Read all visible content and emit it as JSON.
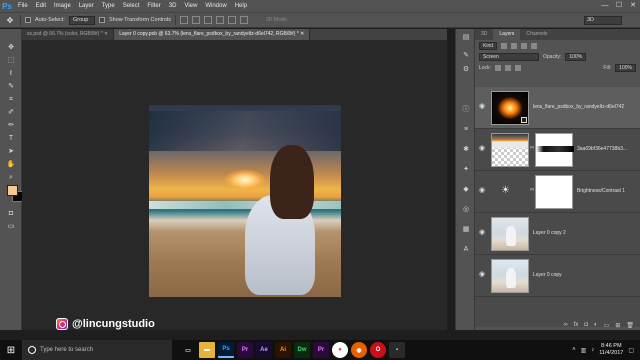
{
  "app": {
    "logo": "Ps"
  },
  "menu": [
    "File",
    "Edit",
    "Image",
    "Layer",
    "Type",
    "Select",
    "Filter",
    "3D",
    "View",
    "Window",
    "Help"
  ],
  "window_controls": {
    "minimize": "—",
    "maximize": "☐",
    "close": "✕"
  },
  "options": {
    "auto_select_label": "Auto-Select:",
    "auto_select_value": "Group",
    "transform_label": "Show Transform Controls",
    "mode_3d": "3D Mode:",
    "search_value": "3D"
  },
  "tabs": [
    {
      "label": "ss.psd @ 66.7% (color, RGB/8#) * ✕",
      "active": false
    },
    {
      "label": "Layer 0 copy.psb @ 63.7% (lens_flare_psdbox_by_randyeltz-d6el742, RGB/8#) * ✕",
      "active": true
    }
  ],
  "watermark": {
    "handle": "@lincungstudio",
    "icon": "instagram-icon"
  },
  "layers_panel": {
    "tabs": [
      "3D",
      "Layers",
      "Channels"
    ],
    "active_tab": "Layers",
    "filter_kind": "Kind",
    "blend_mode": "Screen",
    "opacity_label": "Opacity:",
    "opacity_value": "100%",
    "lock_label": "Lock:",
    "fill_label": "Fill:",
    "fill_value": "100%",
    "layers": [
      {
        "name": "lens_flare_psdbox_by_randyeltz-d6el742",
        "thumb": "flare",
        "selected": true
      },
      {
        "name": "3aa69bf36e47738b3...",
        "thumb": "sky",
        "mask": true
      },
      {
        "name": "Brightness/Contrast 1",
        "thumb": "adjustment",
        "mask": true
      },
      {
        "name": "Layer 0 copy 2",
        "thumb": "photo"
      },
      {
        "name": "Layer 0 copy",
        "thumb": "photo"
      }
    ],
    "footer_icons": [
      "link-icon",
      "fx-icon",
      "mask-icon",
      "adjustment-icon",
      "folder-icon",
      "new-layer-icon",
      "trash-icon"
    ]
  },
  "taskbar": {
    "search_placeholder": "Type here to search",
    "apps": [
      "task-view",
      "file-explorer",
      "Ps",
      "Pr",
      "Ae",
      "Ai",
      "Dw",
      "Pr",
      "Chrome",
      "Firefox",
      "Opera",
      "Other"
    ],
    "time": "8:46 PM",
    "date": "11/4/2017"
  },
  "colors": {
    "foreground": "#f7c990",
    "background": "#050505",
    "ps_blue": "#31a8ff"
  }
}
